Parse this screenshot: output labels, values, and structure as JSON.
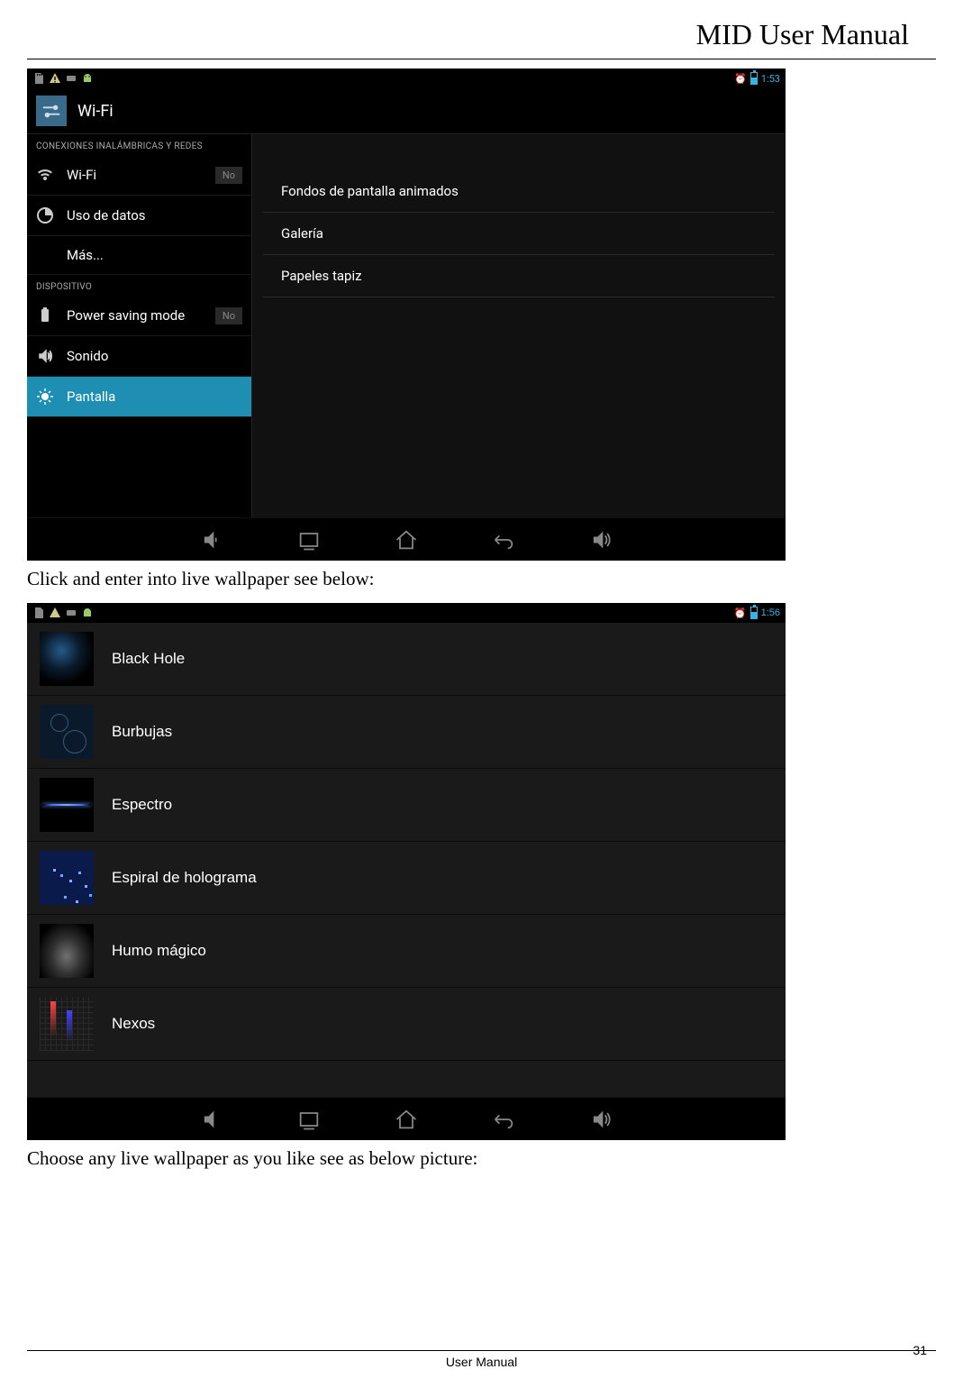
{
  "doc": {
    "title": "MID User Manual",
    "footer": "User Manual",
    "page_number": "31",
    "caption1": "Click and enter into live wallpaper see below:",
    "caption2": "Choose any live wallpaper as you like see as below picture:"
  },
  "shot1": {
    "status": {
      "time": "1:53"
    },
    "header_title": "Wi-Fi",
    "sidebar": {
      "section1": "CONEXIONES INALÁMBRICAS Y REDES",
      "wifi": "Wi-Fi",
      "wifi_toggle": "No",
      "datos": "Uso de datos",
      "mas": "Más...",
      "section2": "DISPOSITIVO",
      "power": "Power saving mode",
      "power_toggle": "No",
      "sonido": "Sonido",
      "pantalla": "Pantalla"
    },
    "content": {
      "item1": "Fondos de pantalla animados",
      "item2": "Galería",
      "item3": "Papeles tapiz"
    }
  },
  "shot2": {
    "status": {
      "time": "1:56"
    },
    "items": {
      "blackhole": "Black Hole",
      "burbujas": "Burbujas",
      "espectro": "Espectro",
      "espiral": "Espiral de holograma",
      "humo": "Humo mágico",
      "nexos": "Nexos"
    }
  }
}
